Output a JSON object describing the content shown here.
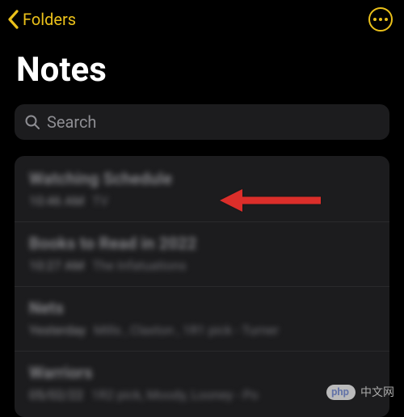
{
  "nav": {
    "back_label": "Folders"
  },
  "header": {
    "title": "Notes"
  },
  "search": {
    "placeholder": "Search"
  },
  "notes": [
    {
      "title": "Watching Schedule",
      "time": "10:46 AM",
      "preview": "TV"
    },
    {
      "title": "Books to Read in 2022",
      "time": "10:27 AM",
      "preview": "The Infatuations"
    },
    {
      "title": "Nets",
      "time": "Yesterday",
      "preview": "Mills , Claxton , 1R1 pick - Turner"
    },
    {
      "title": "Warriors",
      "time": "05/02/22",
      "preview": "1R2 pick, Moody, Looney - Po"
    }
  ],
  "watermark": {
    "badge_text": "php",
    "site_text": "中文网"
  },
  "colors": {
    "accent": "#ebc11a",
    "arrow": "#db2e2a"
  }
}
